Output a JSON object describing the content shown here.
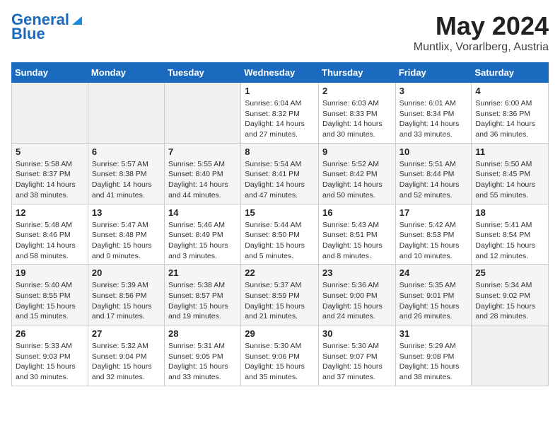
{
  "logo": {
    "line1": "General",
    "line2": "Blue"
  },
  "title": "May 2024",
  "location": "Muntlix, Vorarlberg, Austria",
  "weekdays": [
    "Sunday",
    "Monday",
    "Tuesday",
    "Wednesday",
    "Thursday",
    "Friday",
    "Saturday"
  ],
  "weeks": [
    [
      {
        "day": "",
        "info": ""
      },
      {
        "day": "",
        "info": ""
      },
      {
        "day": "",
        "info": ""
      },
      {
        "day": "1",
        "info": "Sunrise: 6:04 AM\nSunset: 8:32 PM\nDaylight: 14 hours\nand 27 minutes."
      },
      {
        "day": "2",
        "info": "Sunrise: 6:03 AM\nSunset: 8:33 PM\nDaylight: 14 hours\nand 30 minutes."
      },
      {
        "day": "3",
        "info": "Sunrise: 6:01 AM\nSunset: 8:34 PM\nDaylight: 14 hours\nand 33 minutes."
      },
      {
        "day": "4",
        "info": "Sunrise: 6:00 AM\nSunset: 8:36 PM\nDaylight: 14 hours\nand 36 minutes."
      }
    ],
    [
      {
        "day": "5",
        "info": "Sunrise: 5:58 AM\nSunset: 8:37 PM\nDaylight: 14 hours\nand 38 minutes."
      },
      {
        "day": "6",
        "info": "Sunrise: 5:57 AM\nSunset: 8:38 PM\nDaylight: 14 hours\nand 41 minutes."
      },
      {
        "day": "7",
        "info": "Sunrise: 5:55 AM\nSunset: 8:40 PM\nDaylight: 14 hours\nand 44 minutes."
      },
      {
        "day": "8",
        "info": "Sunrise: 5:54 AM\nSunset: 8:41 PM\nDaylight: 14 hours\nand 47 minutes."
      },
      {
        "day": "9",
        "info": "Sunrise: 5:52 AM\nSunset: 8:42 PM\nDaylight: 14 hours\nand 50 minutes."
      },
      {
        "day": "10",
        "info": "Sunrise: 5:51 AM\nSunset: 8:44 PM\nDaylight: 14 hours\nand 52 minutes."
      },
      {
        "day": "11",
        "info": "Sunrise: 5:50 AM\nSunset: 8:45 PM\nDaylight: 14 hours\nand 55 minutes."
      }
    ],
    [
      {
        "day": "12",
        "info": "Sunrise: 5:48 AM\nSunset: 8:46 PM\nDaylight: 14 hours\nand 58 minutes."
      },
      {
        "day": "13",
        "info": "Sunrise: 5:47 AM\nSunset: 8:48 PM\nDaylight: 15 hours\nand 0 minutes."
      },
      {
        "day": "14",
        "info": "Sunrise: 5:46 AM\nSunset: 8:49 PM\nDaylight: 15 hours\nand 3 minutes."
      },
      {
        "day": "15",
        "info": "Sunrise: 5:44 AM\nSunset: 8:50 PM\nDaylight: 15 hours\nand 5 minutes."
      },
      {
        "day": "16",
        "info": "Sunrise: 5:43 AM\nSunset: 8:51 PM\nDaylight: 15 hours\nand 8 minutes."
      },
      {
        "day": "17",
        "info": "Sunrise: 5:42 AM\nSunset: 8:53 PM\nDaylight: 15 hours\nand 10 minutes."
      },
      {
        "day": "18",
        "info": "Sunrise: 5:41 AM\nSunset: 8:54 PM\nDaylight: 15 hours\nand 12 minutes."
      }
    ],
    [
      {
        "day": "19",
        "info": "Sunrise: 5:40 AM\nSunset: 8:55 PM\nDaylight: 15 hours\nand 15 minutes."
      },
      {
        "day": "20",
        "info": "Sunrise: 5:39 AM\nSunset: 8:56 PM\nDaylight: 15 hours\nand 17 minutes."
      },
      {
        "day": "21",
        "info": "Sunrise: 5:38 AM\nSunset: 8:57 PM\nDaylight: 15 hours\nand 19 minutes."
      },
      {
        "day": "22",
        "info": "Sunrise: 5:37 AM\nSunset: 8:59 PM\nDaylight: 15 hours\nand 21 minutes."
      },
      {
        "day": "23",
        "info": "Sunrise: 5:36 AM\nSunset: 9:00 PM\nDaylight: 15 hours\nand 24 minutes."
      },
      {
        "day": "24",
        "info": "Sunrise: 5:35 AM\nSunset: 9:01 PM\nDaylight: 15 hours\nand 26 minutes."
      },
      {
        "day": "25",
        "info": "Sunrise: 5:34 AM\nSunset: 9:02 PM\nDaylight: 15 hours\nand 28 minutes."
      }
    ],
    [
      {
        "day": "26",
        "info": "Sunrise: 5:33 AM\nSunset: 9:03 PM\nDaylight: 15 hours\nand 30 minutes."
      },
      {
        "day": "27",
        "info": "Sunrise: 5:32 AM\nSunset: 9:04 PM\nDaylight: 15 hours\nand 32 minutes."
      },
      {
        "day": "28",
        "info": "Sunrise: 5:31 AM\nSunset: 9:05 PM\nDaylight: 15 hours\nand 33 minutes."
      },
      {
        "day": "29",
        "info": "Sunrise: 5:30 AM\nSunset: 9:06 PM\nDaylight: 15 hours\nand 35 minutes."
      },
      {
        "day": "30",
        "info": "Sunrise: 5:30 AM\nSunset: 9:07 PM\nDaylight: 15 hours\nand 37 minutes."
      },
      {
        "day": "31",
        "info": "Sunrise: 5:29 AM\nSunset: 9:08 PM\nDaylight: 15 hours\nand 38 minutes."
      },
      {
        "day": "",
        "info": ""
      }
    ]
  ]
}
